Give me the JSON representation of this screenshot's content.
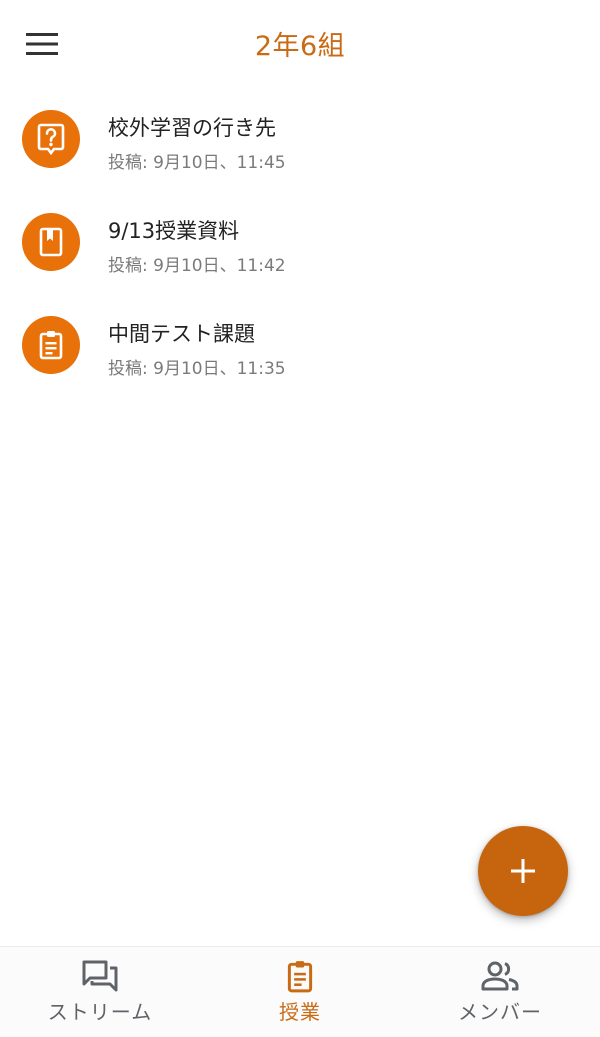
{
  "header": {
    "title": "2年6組",
    "menu_icon": "hamburger-menu-icon"
  },
  "items": [
    {
      "icon": "question-icon",
      "title": "校外学習の行き先",
      "meta": "投稿: 9月10日、11:45"
    },
    {
      "icon": "material-book-icon",
      "title": "9/13授業資料",
      "meta": "投稿: 9月10日、11:42"
    },
    {
      "icon": "assignment-clipboard-icon",
      "title": "中間テスト課題",
      "meta": "投稿: 9月10日、11:35"
    }
  ],
  "fab": {
    "icon": "plus-icon"
  },
  "bottom_nav": {
    "tabs": [
      {
        "label": "ストリーム",
        "icon": "forum-icon",
        "active": false
      },
      {
        "label": "授業",
        "icon": "assignment-icon",
        "active": true
      },
      {
        "label": "メンバー",
        "icon": "people-icon",
        "active": false
      }
    ]
  },
  "colors": {
    "accent": "#c96a14",
    "item_icon_bg": "#e8710a",
    "fab_bg": "#c7650f",
    "inactive_nav": "#5f6368"
  }
}
